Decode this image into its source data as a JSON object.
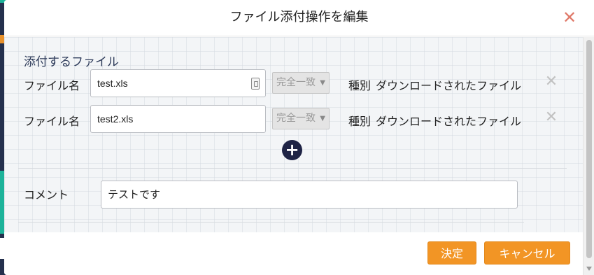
{
  "modal": {
    "title": "ファイル添付操作を編集",
    "close_icon": "close-icon"
  },
  "attachments": {
    "section_label": "添付するファイル",
    "rows": [
      {
        "label": "ファイル名",
        "filename": "test.xls",
        "match_mode": "完全一致",
        "type_label": "種別",
        "type_value": "ダウンロードされたファイル"
      },
      {
        "label": "ファイル名",
        "filename": "test2.xls",
        "match_mode": "完全一致",
        "type_label": "種別",
        "type_value": "ダウンロードされたファイル"
      }
    ],
    "add_icon": "plus-circle-icon"
  },
  "comment": {
    "label": "コメント",
    "value": "テストです"
  },
  "footer": {
    "ok_label": "決定",
    "cancel_label": "キャンセル"
  },
  "colors": {
    "accent_button": "#f29525",
    "close_icon": "#e07a6a",
    "add_button": "#1f2445"
  }
}
